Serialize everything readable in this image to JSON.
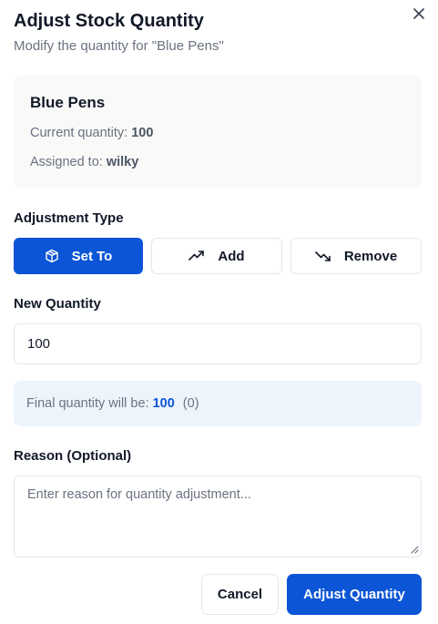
{
  "dialog": {
    "title": "Adjust Stock Quantity",
    "subtitle": "Modify the quantity for \"Blue Pens\"",
    "close_icon": "close-icon"
  },
  "item": {
    "name": "Blue Pens",
    "current_quantity_label": "Current quantity:",
    "current_quantity": "100",
    "assigned_label": "Assigned to:",
    "assigned_to": "wilky"
  },
  "adjustment_type": {
    "label": "Adjustment Type",
    "selected": "Set To",
    "options": [
      {
        "label": "Set To",
        "icon": "cube-icon",
        "active": true
      },
      {
        "label": "Add",
        "icon": "trending-up-icon",
        "active": false
      },
      {
        "label": "Remove",
        "icon": "trending-down-icon",
        "active": false
      }
    ]
  },
  "new_quantity": {
    "label": "New Quantity",
    "value": "100"
  },
  "final": {
    "text": "Final quantity will be:",
    "value": "100",
    "diff": "(0)"
  },
  "reason": {
    "label": "Reason (Optional)",
    "placeholder": "Enter reason for quantity adjustment...",
    "value": ""
  },
  "actions": {
    "cancel_label": "Cancel",
    "submit_label": "Adjust Quantity"
  },
  "colors": {
    "primary": "#0b55d6",
    "info_bg": "#eef4fc",
    "card_bg": "#f9f9f8"
  }
}
